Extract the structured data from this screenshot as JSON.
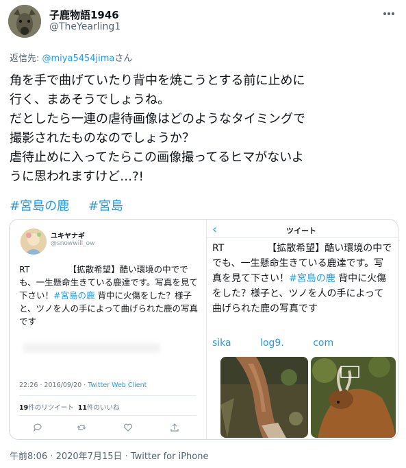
{
  "tweet": {
    "display_name": "子鹿物語1946",
    "handle": "@TheYearling1",
    "reply_prefix": "返信先: ",
    "reply_to": "@miya5454jima",
    "reply_suffix": "さん",
    "body": "角を手で曲げていたり背中を焼こうとする前に止めに\n行く、まあそうでしょうね。\nだとしたら一連の虐待画像はどのようなタイミングで\n撮影されたものなのでしょうか？\n虐待止めに入ってたらこの画像撮ってるヒマがないよ\nうに思われますけど…?!",
    "hashtags": [
      "#宮島の鹿",
      "#宮島"
    ],
    "timestamp": "午前8:06 · 2020年7月15日 · Twitter for iPhone"
  },
  "embed_left": {
    "name": "ユキヤナギ",
    "handle": "@snowwill_ow",
    "text_before": "RT　　　　　【拡散希望】酷い環境の中ででも、一生懸命生きている鹿達です。写真を見て下さい！",
    "hashtag": "#宮島の鹿",
    "text_after": " 背中に火傷をした？様子と、ツノを人の手によって曲げられた鹿の写真です",
    "meta": "22:26 · 2016/09/20 · ",
    "client": "Twitter Web Client",
    "retweets_num": "19",
    "retweets_label": "件のリツイート",
    "likes_num": "11",
    "likes_label": "件のいいね"
  },
  "embed_right": {
    "back": "‹",
    "title": "ツイート",
    "text_before": "RT　　　　　【拡散希望】酷い環境の中ででも、一生懸命生きている鹿達です。写真を見て下さい！",
    "hashtag": "#宮島の鹿",
    "text_after": " 背中に火傷をした？様子と、ツノを人の手によって曲げられた鹿の写真です",
    "link": "sika log9. com"
  }
}
